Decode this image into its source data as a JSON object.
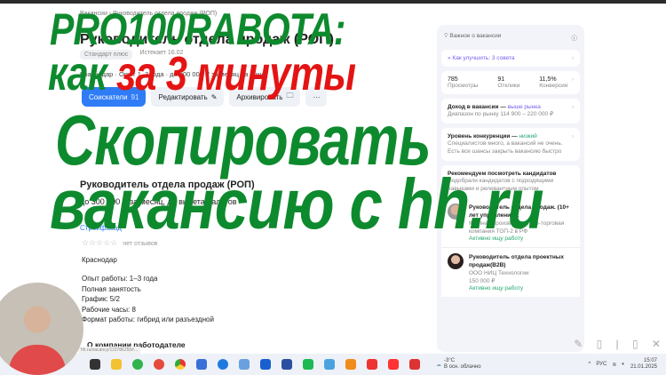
{
  "page": {
    "breadcrumb": "Вакансии › Руководитель отдела продаж (РОП)",
    "title": "Руководитель отдела продаж (РОП)",
    "badges": [
      "Стандарт плюс",
      "Истекает 16.02"
    ],
    "meta": "Краснодар · Опыт 1–3 года · до 300 000 ₽ за месяц на руки",
    "buttons": {
      "applicants": "Соискатели",
      "applicants_count": "91",
      "edit": "Редактировать",
      "archive": "Архивировать",
      "more": "···"
    },
    "section_title": "Руководитель отдела продаж (РОП)",
    "salary": "до 300 000 ₽ за месяц, до вычета налогов",
    "company": "Стройфасад",
    "stars": "☆☆☆☆☆",
    "no_reviews": "нет отзывов",
    "city": "Краснодар",
    "facts": [
      "Опыт работы: 1–3 года",
      "Полная занятость",
      "График: 5/2",
      "Рабочие часы: 8",
      "Формат работы: гибрид или разъездной"
    ],
    "about": "О компании работодателе",
    "status_url": "hh.ru/vacancy/115786255#..."
  },
  "panel": {
    "header": "Важное о вакансии",
    "tips": "Как улучшить: 3 совета",
    "stats": [
      {
        "value": "785",
        "label": "Просмотры"
      },
      {
        "value": "91",
        "label": "Отклики"
      },
      {
        "value": "11,5%",
        "label": "Конверсия"
      }
    ],
    "income_title": "Доход в вакансии —",
    "income_level": "выше рынка",
    "income_range": "Диапазон по рынку 114 900 – 220 000 ₽",
    "competition_title": "Уровень конкуренции —",
    "competition_level": "низкий",
    "competition_text": "Специалистов много, а вакансий не очень. Есть все шансы закрыть вакансию быстро",
    "watch_title": "Рекомендуем посмотреть кандидатов",
    "watch_text": "Подобрали кандидатов с подходящими навыками и релевантным опытом",
    "candidates": [
      {
        "title": "Руководитель отдела продаж. (10+ лет управления...",
        "company": "Крупная производственно-торговая компания ТОП-2 в РФ",
        "status": "Активно ищу работу"
      },
      {
        "title": "Руководитель отдела проектных продаж(B2B)",
        "company": "ООО НИЦ Технологии",
        "salary": "150 000 ₽",
        "status": "Активно ищу работу"
      }
    ]
  },
  "taskbar": {
    "weather_temp": "-3°C",
    "weather_desc": "В осн. облачно",
    "lang": "РУС",
    "time": "15:07",
    "date": "21.01.2025"
  },
  "overlay": {
    "line1": "PRO100RABOTA:",
    "line2a": "как",
    "line2b": "за 3 минуты",
    "line3": "Скопировать",
    "line4": "вакансию с hh.ru"
  },
  "colors": {
    "green": "#0e8a2e",
    "red": "#e41414",
    "accent": "#2f7cf6"
  }
}
